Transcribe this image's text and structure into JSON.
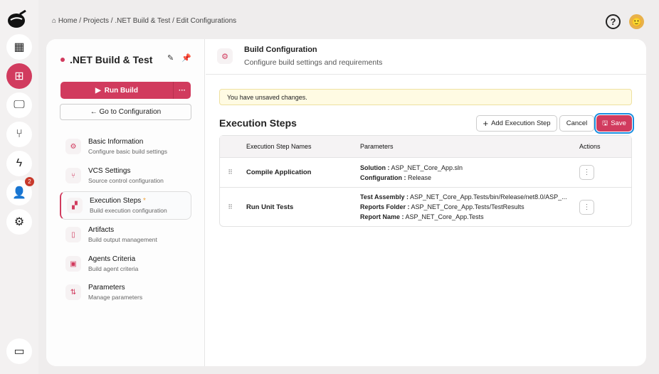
{
  "breadcrumb": [
    "Home",
    "Projects",
    ".NET Build & Test",
    "Edit Configurations"
  ],
  "rail": {
    "notification_count": "2"
  },
  "project": {
    "title": ".NET Build & Test",
    "run_label": "Run Build",
    "more_label": "···",
    "goto_label": "← Go to Configuration"
  },
  "nav": [
    {
      "title": "Basic Information",
      "subtitle": "Configure basic build settings",
      "icon": "gear-icon"
    },
    {
      "title": "VCS Settings",
      "subtitle": "Source control configuration",
      "icon": "branch-icon"
    },
    {
      "title": "Execution Steps",
      "subtitle": "Build execution configuration",
      "icon": "steps-icon",
      "modified": "*"
    },
    {
      "title": "Artifacts",
      "subtitle": "Build output management",
      "icon": "file-icon"
    },
    {
      "title": "Agents Criteria",
      "subtitle": "Build agent criteria",
      "icon": "agent-icon"
    },
    {
      "title": "Parameters",
      "subtitle": "Manage parameters",
      "icon": "sliders-icon"
    }
  ],
  "header": {
    "title": "Build Configuration",
    "subtitle": "Configure build settings and requirements"
  },
  "notice": "You have unsaved changes.",
  "section": {
    "title": "Execution Steps",
    "add_label": "Add Execution Step",
    "cancel_label": "Cancel",
    "save_label": "Save"
  },
  "table": {
    "columns": [
      "Execution Step Names",
      "Parameters",
      "Actions"
    ],
    "rows": [
      {
        "name": "Compile Application",
        "params": [
          {
            "k": "Solution :",
            "v": "ASP_NET_Core_App.sln"
          },
          {
            "k": "Configuration :",
            "v": "Release"
          }
        ]
      },
      {
        "name": "Run Unit Tests",
        "params": [
          {
            "k": "Test Assembly :",
            "v": "ASP_NET_Core_App.Tests/bin/Release/net8.0/ASP_..."
          },
          {
            "k": "Reports Folder :",
            "v": "ASP_NET_Core_App.Tests/TestResults"
          },
          {
            "k": "Report Name :",
            "v": "ASP_NET_Core_App.Tests"
          }
        ]
      }
    ]
  }
}
